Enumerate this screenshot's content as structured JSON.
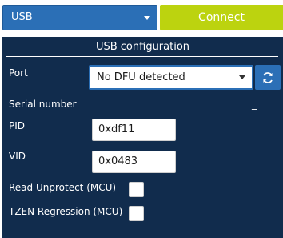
{
  "topbar": {
    "interface_value": "USB",
    "connect_label": "Connect"
  },
  "usb_config": {
    "title": "USB configuration",
    "port_label": "Port",
    "port_value": "No DFU detected",
    "serial_number_label": "Serial number",
    "serial_number_value": "_",
    "pid_label": "PID",
    "pid_value": "0xdf11",
    "vid_label": "VID",
    "vid_value": "0x0483",
    "read_unprotect_label": "Read Unprotect (MCU)",
    "read_unprotect_checked": false,
    "tzen_regression_label": "TZEN Regression (MCU)",
    "tzen_regression_checked": false
  },
  "colors": {
    "accent_blue": "#2b6fb6",
    "connect_green": "#bcd30f",
    "panel_navy": "#112c4d"
  },
  "icons": {
    "refresh": "refresh-icon",
    "dropdown": "chevron-down-icon"
  }
}
